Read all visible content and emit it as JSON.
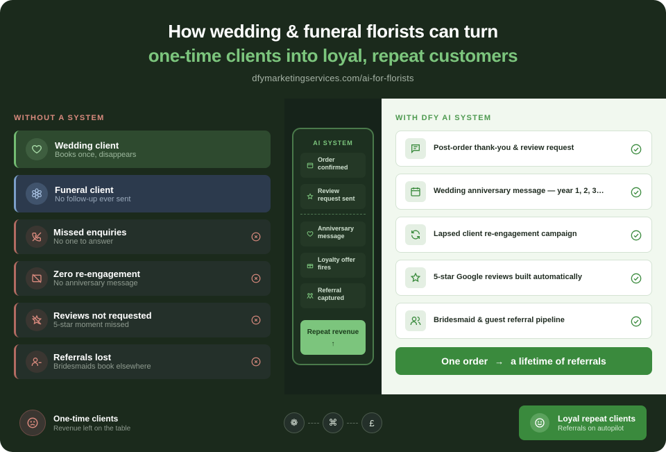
{
  "header": {
    "title_line1": "How wedding & funeral florists can turn",
    "title_line2": "one-time clients into loyal, repeat customers",
    "url": "dfymarketingservices.com/ai-for-florists"
  },
  "without": {
    "label": "WITHOUT A SYSTEM",
    "cards": [
      {
        "title": "Wedding client",
        "subtitle": "Books once, disappears",
        "icon": "heart-icon",
        "kind": "good"
      },
      {
        "title": "Funeral client",
        "subtitle": "No follow-up ever sent",
        "icon": "flower-icon",
        "kind": "blue"
      },
      {
        "title": "Missed enquiries",
        "subtitle": "No one to answer",
        "icon": "phone-off-icon",
        "kind": "bad"
      },
      {
        "title": "Zero re-engagement",
        "subtitle": "No anniversary message",
        "icon": "message-off-icon",
        "kind": "bad"
      },
      {
        "title": "Reviews not requested",
        "subtitle": "5-star moment missed",
        "icon": "star-off-icon",
        "kind": "bad"
      },
      {
        "title": "Referrals lost",
        "subtitle": "Bridesmaids book elsewhere",
        "icon": "user-minus-icon",
        "kind": "bad"
      }
    ]
  },
  "ai_system": {
    "label": "AI SYSTEM",
    "steps": [
      {
        "text": "Order confirmed",
        "icon": "calendar-icon"
      },
      {
        "text": "Review request sent",
        "icon": "star-icon"
      },
      {
        "text": "Anniversary message",
        "icon": "heart-icon"
      },
      {
        "text": "Loyalty offer fires",
        "icon": "gift-icon"
      },
      {
        "text": "Referral captured",
        "icon": "people-icon"
      }
    ],
    "result": "Repeat revenue",
    "result_arrow": "↑"
  },
  "with": {
    "label": "WITH DFY AI SYSTEM",
    "items": [
      {
        "text": "Post-order thank-you & review request",
        "icon": "message-heart-icon"
      },
      {
        "text": "Wedding anniversary message — year 1, 2, 3…",
        "icon": "calendar-heart-icon"
      },
      {
        "text": "Lapsed client re-engagement campaign",
        "icon": "refresh-icon"
      },
      {
        "text": "5-star Google reviews built automatically",
        "icon": "star-icon"
      },
      {
        "text": "Bridesmaid & guest referral pipeline",
        "icon": "users-icon"
      }
    ],
    "cta": {
      "left": "One order",
      "arrow": "→",
      "right": "a lifetime of referrals"
    }
  },
  "footer": {
    "left_title": "One-time clients",
    "left_subtitle": "Revenue left on the table",
    "tokens": [
      "❁",
      "⌘",
      "£"
    ],
    "right_title": "Loyal repeat clients",
    "right_subtitle": "Referrals on autopilot"
  },
  "colors": {
    "background": "#1b2a1c",
    "accent_green": "#7cc57d",
    "warning_red": "#d98a7e",
    "cta_green": "#3a8a3d"
  }
}
